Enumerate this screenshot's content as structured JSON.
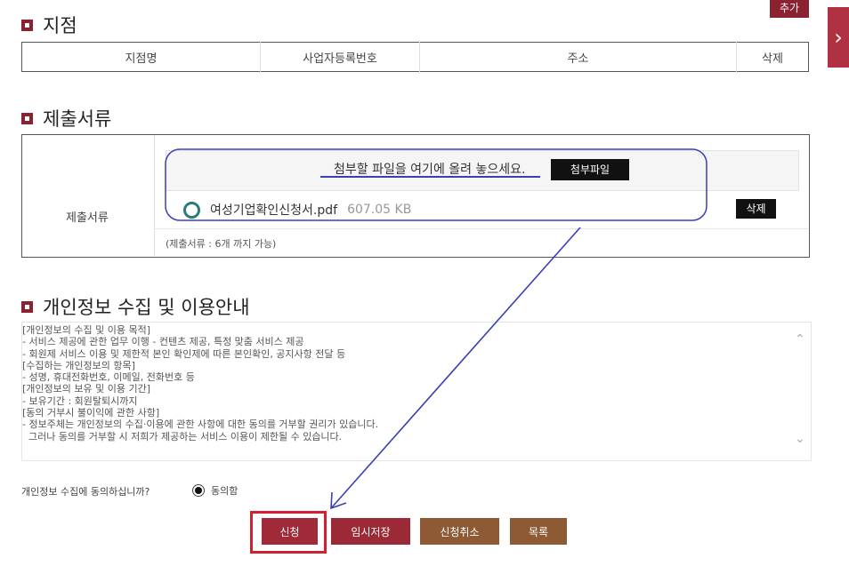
{
  "branch": {
    "title": "지점",
    "add_label": "추가",
    "columns": [
      "지점명",
      "사업자등록번호",
      "주소",
      "삭제"
    ]
  },
  "side_tab": {
    "icon": "chevron-right-icon",
    "glyph": "›"
  },
  "documents": {
    "title": "제출서류",
    "row_label": "제출서류",
    "drop_text": "첨부할 파일을 여기에 올려 놓으세요.",
    "attach_label": "첨부파일",
    "file_name": "여성기업확인신청서.pdf",
    "file_size": "607.05 KB",
    "delete_label": "삭제",
    "note": "(제출서류 : 6개 까지 가능)"
  },
  "privacy": {
    "title": "개인정보 수집 및 이용안내",
    "text": "[개인정보의 수집 및 이용 목적]\n- 서비스 제공에 관한 업무 이행 - 컨텐츠 제공, 특정 맞춤 서비스 제공\n- 회원제 서비스 이용 및 제한적 본인 확인제에 따른 본인확인, 공지사항 전달 등\n[수집하는 개인정보의 항목]\n- 성명, 휴대전화번호, 이메일, 전화번호 등\n[개인정보의 보유 및 이용 기간]\n- 보유기간 : 회원탈퇴시까지\n[동의 거부시 불이익에 관한 사항]\n- 정보주체는 개인정보의 수집·이용에 관한 사항에 대한 동의를 거부할 권리가 있습니다.\n  그러나 동의를 거부할 시 저희가 제공하는 서비스 이용이 제한될 수 있습니다.",
    "consent_question": "개인정보 수집에 동의하십니까?",
    "consent_option": "동의함",
    "consent_checked": true
  },
  "actions": {
    "apply": "신청",
    "temp_save": "임시저장",
    "cancel": "신청취소",
    "list": "목록"
  },
  "colors": {
    "accent": "#8b2131",
    "apply_btn": "#a02a37",
    "temp_btn": "#9b2a36",
    "brown_btn": "#8e5a34",
    "highlight": "#d2202f",
    "annotation": "#3a3fb8"
  }
}
